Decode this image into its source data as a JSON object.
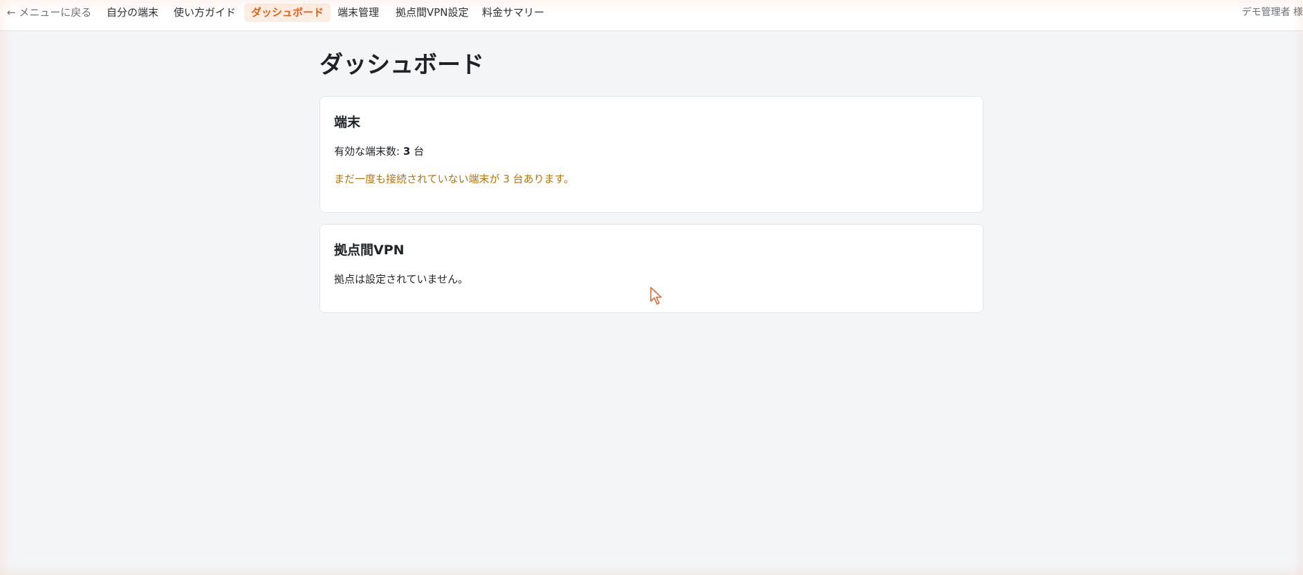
{
  "nav": {
    "back": "← メニューに戻る",
    "items": [
      "自分の端末",
      "使い方ガイド",
      "ダッシュボード",
      "端末管理",
      "拠点間VPN設定",
      "料金サマリー"
    ],
    "active_index": 2,
    "user": "デモ管理者 様"
  },
  "page": {
    "title": "ダッシュボード"
  },
  "devices_card": {
    "title": "端末",
    "count_label": "有効な端末数:",
    "count_value": "3",
    "count_unit": "台",
    "warning": "まだ一度も接続されていない端末が 3 台あります。"
  },
  "vpn_card": {
    "title": "拠点間VPN",
    "status": "拠点は設定されていません。"
  },
  "colors": {
    "accent": "#e0631c",
    "accent_bg": "#fdeee3",
    "warning": "#b8730a",
    "page_bg": "#f4f5f7"
  }
}
